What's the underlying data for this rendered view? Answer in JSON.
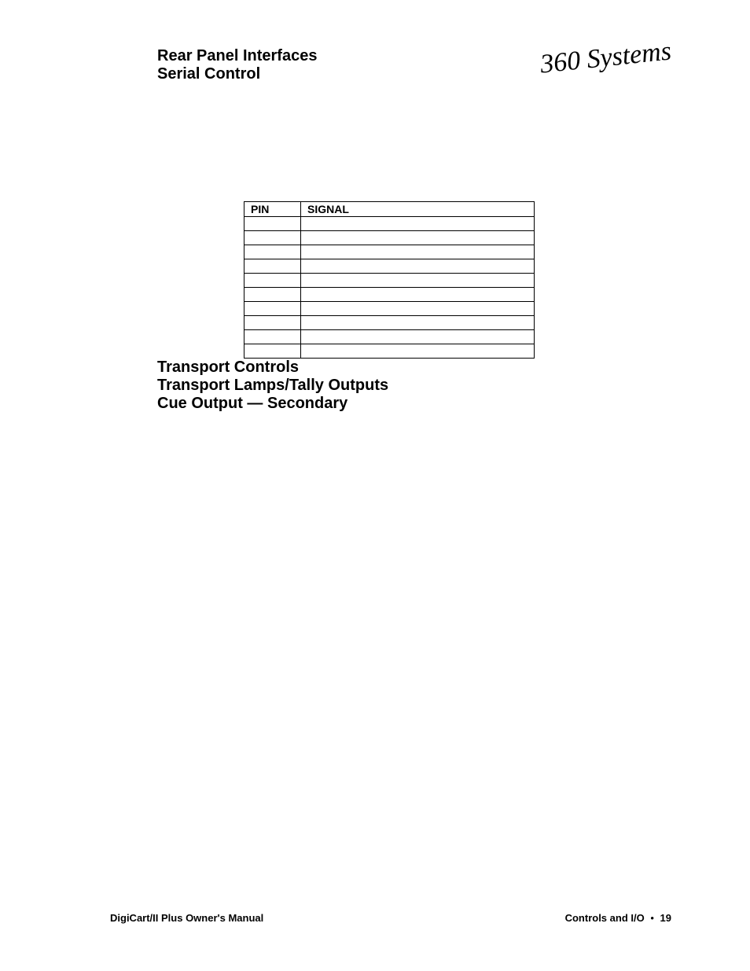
{
  "logo": "360 Systems",
  "headings": {
    "rear_panel": "Rear Panel Interfaces",
    "serial_control": "Serial Control",
    "transport_controls": "Transport Controls",
    "transport_lamps": "Transport Lamps/Tally Outputs",
    "cue_output": "Cue Output — Secondary"
  },
  "table": {
    "header_pin": "PIN",
    "header_signal": "SIGNAL",
    "rows": [
      {
        "pin": "",
        "signal": ""
      },
      {
        "pin": "",
        "signal": ""
      },
      {
        "pin": "",
        "signal": ""
      },
      {
        "pin": "",
        "signal": ""
      },
      {
        "pin": "",
        "signal": ""
      },
      {
        "pin": "",
        "signal": ""
      },
      {
        "pin": "",
        "signal": ""
      },
      {
        "pin": "",
        "signal": ""
      },
      {
        "pin": "",
        "signal": ""
      },
      {
        "pin": "",
        "signal": ""
      }
    ]
  },
  "footer": {
    "left": "DigiCart/II Plus Owner's Manual",
    "right_section": "Controls and I/O",
    "bullet": "•",
    "page": "19"
  }
}
